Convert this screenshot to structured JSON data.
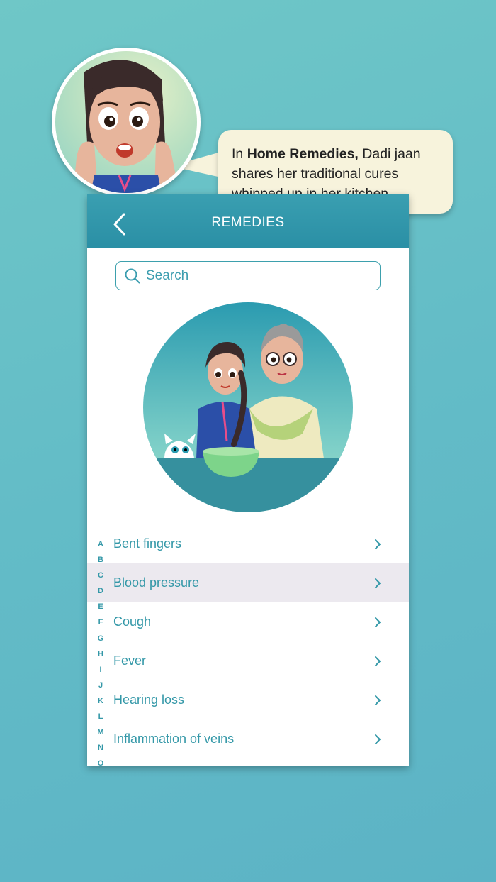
{
  "bubble": {
    "prefix": "In ",
    "bold": "Home Remedies,",
    "rest": " Dadi jaan shares her traditional cures whipped up in her kitchen."
  },
  "header": {
    "title": "REMEDIES"
  },
  "search": {
    "placeholder": "Search"
  },
  "remedies": [
    "Bent fingers",
    "Blood pressure",
    "Cough",
    "Fever",
    "Hearing loss",
    "Inflammation of veins"
  ],
  "selected_index": 1,
  "alphabet": [
    "A",
    "B",
    "C",
    "D",
    "E",
    "F",
    "G",
    "H",
    "I",
    "J",
    "K",
    "L",
    "M",
    "N",
    "O"
  ],
  "colors": {
    "accent": "#3498a8",
    "header": "#2a8fa5",
    "background": "#63bcc7",
    "selected_row": "#ece9ef",
    "bubble": "#f7f3dc"
  },
  "icons": {
    "back": "chevron-left-icon",
    "search": "search-icon",
    "row": "chevron-right-icon"
  }
}
